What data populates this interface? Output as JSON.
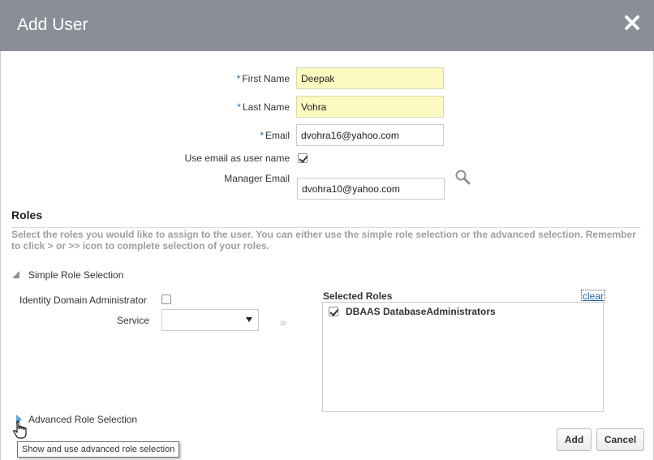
{
  "dialog": {
    "title": "Add User",
    "close_icon": "close-icon"
  },
  "form": {
    "required_marker": "*",
    "first_name": {
      "label": "First Name",
      "value": "Deepak"
    },
    "last_name": {
      "label": "Last Name",
      "value": "Vohra"
    },
    "email": {
      "label": "Email",
      "value": "dvohra16@yahoo.com"
    },
    "use_email": {
      "label": "Use email as user name",
      "checked": true
    },
    "manager_email": {
      "label": "Manager Email",
      "value": "dvohra10@yahoo.com",
      "search_icon": "search-icon"
    }
  },
  "roles": {
    "title": "Roles",
    "hint": "Select the roles you would like to assign to the user. You can either use the simple role selection or the advanced selection. Remember to click > or >> icon to complete selection of your roles.",
    "simple": {
      "label": "Simple Role Selection",
      "expanded": true,
      "identity_admin_label": "Identity Domain Administrator",
      "identity_admin_checked": false,
      "service_label": "Service",
      "service_value": "",
      "move_all_glyph": "»"
    },
    "selected": {
      "label": "Selected Roles",
      "clear_label": "clear",
      "items": [
        {
          "label": "DBAAS DatabaseAdministrators",
          "checked": true
        }
      ]
    },
    "advanced": {
      "label": "Advanced Role Selection",
      "expanded": false,
      "tooltip": "Show and use advanced role selection"
    }
  },
  "buttons": {
    "add": "Add",
    "cancel": "Cancel"
  },
  "colors": {
    "titlebar": "#8a8e98",
    "required_input": "#fcfbbf",
    "accent": "#1a6fb4"
  }
}
